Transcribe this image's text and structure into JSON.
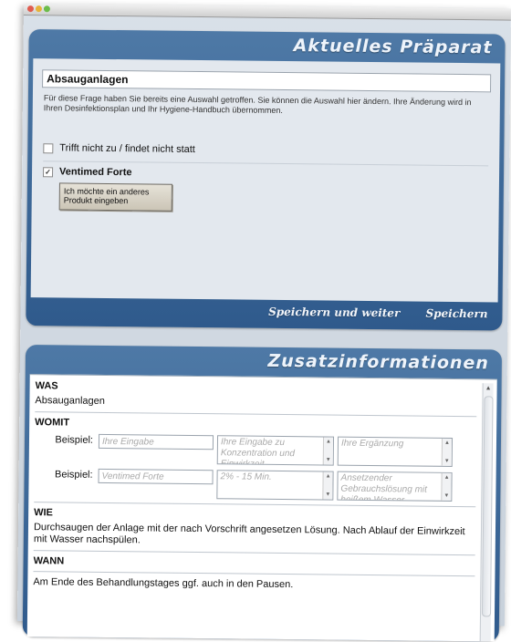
{
  "window": {
    "buttons": [
      "close",
      "minimize",
      "zoom"
    ]
  },
  "current": {
    "title": "Aktuelles Präparat",
    "header": "Absauganlagen",
    "info": "Für diese Frage haben Sie bereits eine Auswahl getroffen. Sie können die Auswahl hier ändern. Ihre Änderung wird in Ihren Desinfektionsplan und Ihr Hygiene-Handbuch übernommen.",
    "option_none": {
      "label": "Trifft nicht zu / findet nicht statt",
      "checked": false
    },
    "option_product": {
      "label": "Ventimed Forte",
      "checked": true,
      "mark": "✓"
    },
    "other_button": "Ich möchte ein anderes Produkt eingeben",
    "save_next": "Speichern und weiter",
    "save": "Speichern"
  },
  "extra": {
    "title": "Zusatzinformationen",
    "was_label": "WAS",
    "was_value": "Absauganlagen",
    "womit_label": "WOMIT",
    "row1": {
      "label": "Beispiel:",
      "input": "Ihre Eingabe",
      "conc": "Ihre Eingabe zu Konzentration und Einwirkzeit",
      "add": "Ihre Ergänzung"
    },
    "row2": {
      "label": "Beispiel:",
      "input": "Ventimed Forte",
      "conc": "2% - 15 Min.",
      "add": "Ansetzender Gebrauchslösung mit heißem Wasser"
    },
    "wie_label": "WIE",
    "wie_value": "Durchsaugen der Anlage mit der nach Vorschrift angesetzen Lösung. Nach Ablauf der Einwirkzeit mit Wasser nachspülen.",
    "wann_label": "WANN",
    "wann_value": "Am Ende des Behandlungstages ggf. auch in den Pausen."
  }
}
